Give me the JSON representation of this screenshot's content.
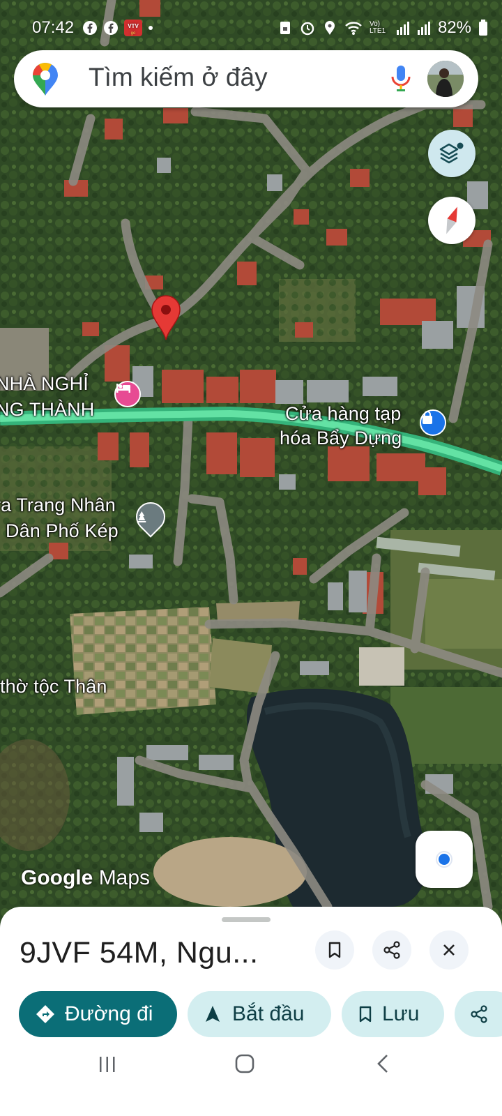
{
  "status_bar": {
    "time": "07:42",
    "battery": "82%",
    "network": "Vo) LTE1"
  },
  "search": {
    "placeholder": "Tìm kiếm ở đây"
  },
  "map": {
    "labels": {
      "guesthouse_line1": "NHÀ NGHỈ",
      "guesthouse_line2": "NG THÀNH",
      "store_line1": "Cửa hàng tạp",
      "store_line2": "hóa Bẩy Dựng",
      "cemetery_line1": "ra Trang Nhân",
      "cemetery_line2": "Dân Phố Kép",
      "shrine": "thờ tộc Thân"
    },
    "attribution": {
      "google": "Google",
      "maps": "Maps"
    }
  },
  "place": {
    "title": "9JVF 54M, Ngu..."
  },
  "actions": {
    "directions": "Đường đi",
    "start": "Bắt đầu",
    "save": "Lưu"
  },
  "colors": {
    "accent_teal": "#0b6e77",
    "chip_light": "#d3eef0",
    "pin_red": "#e53935",
    "road_green": "#3fd08a",
    "poi_pink": "#e74b93",
    "poi_blue": "#1a73e8",
    "poi_gray": "#6b7b7f"
  },
  "icons": {
    "location_pin": "red-map-pin",
    "layers": "layers-icon",
    "compass": "compass-icon",
    "my_location": "my-location-icon",
    "bookmark": "bookmark-icon",
    "share": "share-icon",
    "close": "close-icon",
    "directions": "directions-icon",
    "navigation": "navigation-arrow-icon"
  }
}
